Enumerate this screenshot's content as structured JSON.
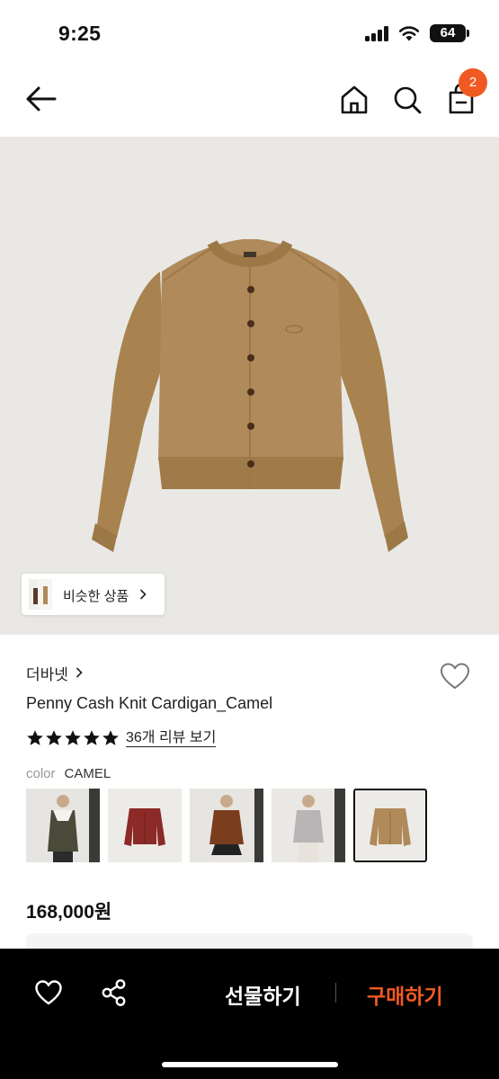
{
  "status_bar": {
    "time": "9:25",
    "battery": "64"
  },
  "nav": {
    "cart_count": "2"
  },
  "hero": {
    "similar_label": "비슷한 상품"
  },
  "product": {
    "brand": "더바넷",
    "name": "Penny Cash Knit Cardigan_Camel",
    "rating": 5,
    "review_link": "36개 리뷰 보기",
    "color_label": "color",
    "color_value": "CAMEL",
    "price": "168,000원"
  },
  "swatches": [
    {
      "name": "model-olive-collar",
      "selected": false
    },
    {
      "name": "burgundy-cardigan",
      "selected": false
    },
    {
      "name": "model-brown",
      "selected": false
    },
    {
      "name": "model-grey",
      "selected": false
    },
    {
      "name": "camel-cardigan",
      "selected": true
    }
  ],
  "bottom_bar": {
    "gift_label": "선물하기",
    "buy_label": "구매하기"
  },
  "colors": {
    "accent": "#f05a22",
    "camel": "#b08a5a",
    "hero_bg": "#e9e8e5"
  }
}
